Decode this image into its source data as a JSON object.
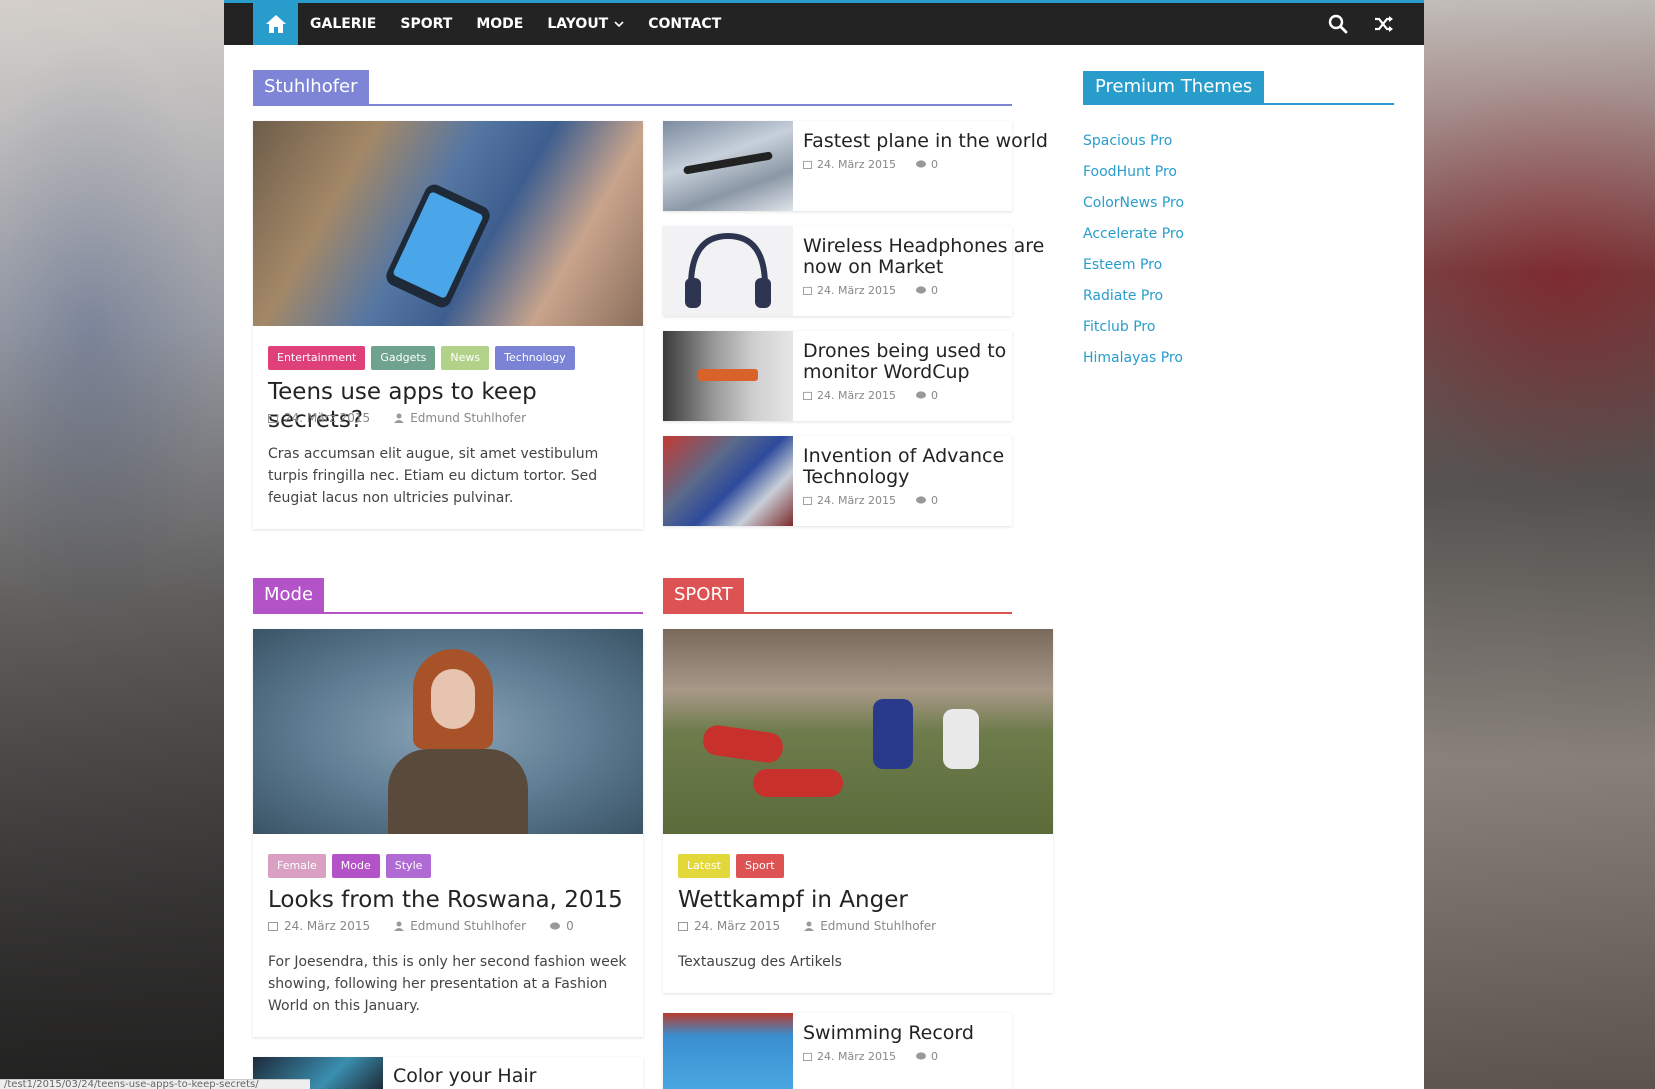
{
  "nav": {
    "items": [
      "GALERIE",
      "SPORT",
      "MODE",
      "LAYOUT",
      "CONTACT"
    ]
  },
  "sections": {
    "stuhlhofer": {
      "label": "Stuhlhofer",
      "color": "#7f85d6"
    },
    "mode": {
      "label": "Mode",
      "color": "#b452c8"
    },
    "sport": {
      "label": "SPORT",
      "color": "#dd5353"
    }
  },
  "featured1": {
    "tags": [
      {
        "label": "Entertainment",
        "color": "#e0407a"
      },
      {
        "label": "Gadgets",
        "color": "#6fa38d"
      },
      {
        "label": "News",
        "color": "#b2d28a"
      },
      {
        "label": "Technology",
        "color": "#7a83d6"
      }
    ],
    "title": "Teens use apps to keep secrets?",
    "date": "24. März 2015",
    "author": "Edmund Stuhlhofer",
    "excerpt": "Cras accumsan elit augue, sit amet vestibulum turpis fringilla nec. Etiam eu dictum tortor. Sed feugiat lacus non ultricies pulvinar."
  },
  "small_posts": [
    {
      "title": "Fastest plane in the world",
      "date": "24. März 2015",
      "comments": "0"
    },
    {
      "title": "Wireless Headphones are now on Market",
      "date": "24. März 2015",
      "comments": "0"
    },
    {
      "title": "Drones being used to monitor WordCup",
      "date": "24. März 2015",
      "comments": "0"
    },
    {
      "title": "Invention of Advance Technology",
      "date": "24. März 2015",
      "comments": "0"
    }
  ],
  "mode_featured": {
    "tags": [
      {
        "label": "Female",
        "color": "#d9a0c4"
      },
      {
        "label": "Mode",
        "color": "#b452c8"
      },
      {
        "label": "Style",
        "color": "#b06ad4"
      }
    ],
    "title": "Looks from the Roswana, 2015",
    "date": "24. März 2015",
    "author": "Edmund Stuhlhofer",
    "comments": "0",
    "excerpt": "For Joesendra, this is only her second fashion week showing, following her presentation at a Fashion World on this January."
  },
  "mode_small": {
    "title": "Color your Hair"
  },
  "sport_featured": {
    "tags": [
      {
        "label": "Latest",
        "color": "#e3d83a"
      },
      {
        "label": "Sport",
        "color": "#dd5353"
      }
    ],
    "title": "Wettkampf in Anger",
    "date": "24. März 2015",
    "author": "Edmund Stuhlhofer",
    "excerpt": "Textauszug des Artikels"
  },
  "sport_small": {
    "title": "Swimming Record",
    "date": "24. März 2015",
    "comments": "0"
  },
  "widget": {
    "title": "Premium Themes",
    "links": [
      "Spacious Pro",
      "FoodHunt Pro",
      "ColorNews Pro",
      "Accelerate Pro",
      "Esteem Pro",
      "Radiate Pro",
      "Fitclub Pro",
      "Himalayas Pro"
    ]
  },
  "status_url": "/test1/2015/03/24/teens-use-apps-to-keep-secrets/",
  "colors": {
    "accent": "#289dcc",
    "navbar": "#232323"
  },
  "icons": [
    "home-icon",
    "search-icon",
    "shuffle-icon",
    "calendar-icon",
    "user-icon",
    "comment-icon",
    "chevron-down-icon"
  ]
}
